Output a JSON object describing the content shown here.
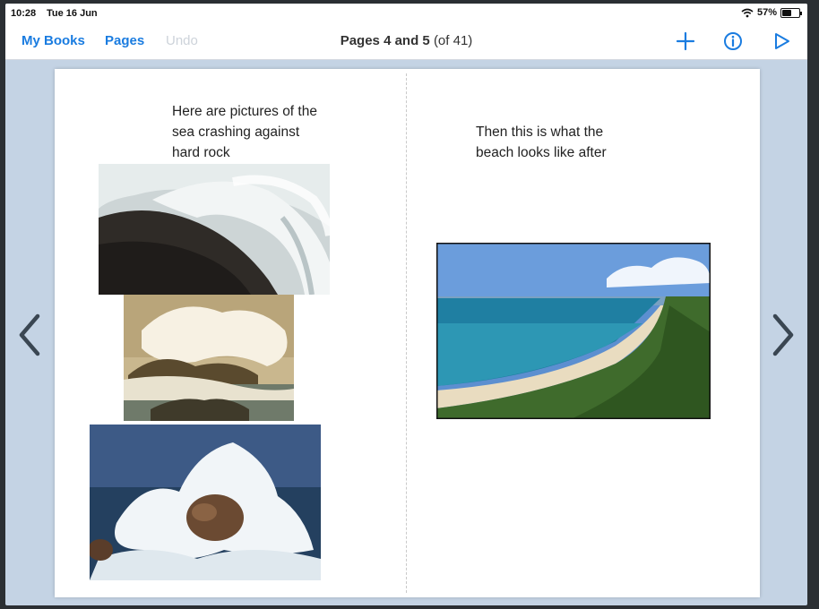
{
  "status": {
    "time": "10:28",
    "date": "Tue 16 Jun",
    "battery": "57%",
    "battery_level": 0.57
  },
  "nav": {
    "my_books": "My Books",
    "pages": "Pages",
    "undo": "Undo",
    "title_bold": "Pages 4 and 5",
    "title_rest": "(of 41)"
  },
  "left_page": {
    "text_line1": "Here are pictures of the",
    "text_line2": "sea crashing against",
    "text_line3": "hard rock"
  },
  "right_page": {
    "text_line1": "Then this is what the",
    "text_line2": "beach looks like after"
  },
  "icons": {
    "add": "plus-icon",
    "info": "info-icon",
    "play": "play-icon",
    "prev": "chevron-left-icon",
    "next": "chevron-right-icon",
    "wifi": "wifi-icon",
    "battery": "battery-icon"
  },
  "colors": {
    "accent": "#1a7ce0",
    "background": "#c4d3e4"
  }
}
